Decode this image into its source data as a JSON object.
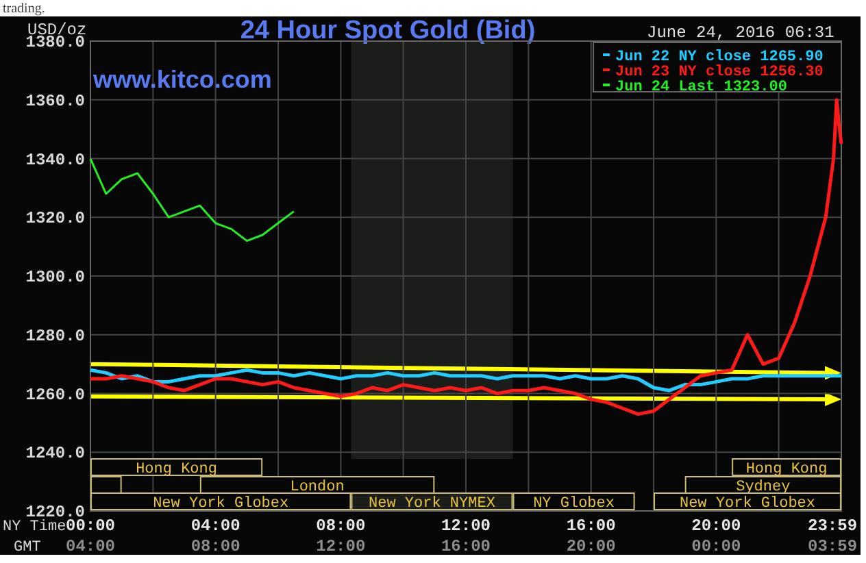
{
  "page_top_text": "trading.",
  "chart": {
    "unit_label": "USD/oz",
    "title": "24 Hour Spot Gold (Bid)",
    "timestamp": "June 24, 2016 06:31",
    "site_label": "www.kitco.com",
    "chart_data": {
      "type": "line",
      "x": [
        0,
        0.5,
        1,
        1.5,
        2,
        2.5,
        3,
        3.5,
        4,
        4.5,
        5,
        5.5,
        6,
        6.5,
        7,
        7.5,
        8,
        8.5,
        9,
        9.5,
        10,
        10.5,
        11,
        11.5,
        12,
        12.5,
        13,
        13.5,
        14,
        14.5,
        15,
        15.5,
        16,
        16.5,
        17,
        17.5,
        18,
        18.5,
        19,
        19.5,
        20,
        20.5,
        21,
        21.5,
        22,
        22.5,
        23,
        23.5,
        23.75,
        23.85,
        23.92,
        24
      ],
      "series": [
        {
          "name": "Jun 22 NY close 1265.90",
          "color": "#22ccff",
          "values": [
            1268,
            1267,
            1265,
            1266,
            1264,
            1264,
            1265,
            1266,
            1266,
            1267,
            1268,
            1267,
            1267,
            1266,
            1267,
            1266,
            1265,
            1266,
            1266,
            1267,
            1266,
            1266,
            1267,
            1266,
            1266,
            1266,
            1265,
            1266,
            1266,
            1266,
            1265,
            1266,
            1265,
            1265,
            1266,
            1265,
            1262,
            1261,
            1263,
            1263,
            1264,
            1265,
            1265,
            1266,
            1266,
            1266,
            1266,
            1266,
            1266,
            1266,
            1266,
            1266
          ]
        },
        {
          "name": "Jun 23 NY close 1256.30",
          "color": "#ff1a1a",
          "values": [
            1265,
            1265,
            1266,
            1265,
            1264,
            1262,
            1261,
            1263,
            1265,
            1265,
            1264,
            1263,
            1264,
            1262,
            1261,
            1260,
            1259,
            1260,
            1262,
            1261,
            1263,
            1262,
            1261,
            1262,
            1261,
            1262,
            1260,
            1261,
            1261,
            1262,
            1261,
            1260,
            1258,
            1257,
            1255,
            1253,
            1254,
            1258,
            1262,
            1266,
            1267,
            1268,
            1280,
            1270,
            1272,
            1284,
            1300,
            1320,
            1340,
            1360,
            1352,
            1345
          ]
        },
        {
          "name": "Jun 24 Last 1323.00",
          "color": "#22ee22",
          "values": [
            1340,
            1328,
            1333,
            1335,
            1328,
            1320,
            1322,
            1324,
            1318,
            1316,
            1312,
            1314,
            1318,
            1322,
            null,
            null,
            null,
            null,
            null,
            null,
            null,
            null,
            null,
            null,
            null,
            null,
            null,
            null,
            null,
            null,
            null,
            null,
            null,
            null,
            null,
            null,
            null,
            null,
            null,
            null,
            null,
            null,
            null,
            null,
            null,
            null,
            null,
            null,
            null,
            null,
            null,
            null
          ]
        }
      ],
      "xlim": [
        0,
        24
      ],
      "ylim": [
        1220,
        1380
      ],
      "xticks": [
        {
          "value": 0,
          "label": "00:00"
        },
        {
          "value": 4,
          "label": "04:00"
        },
        {
          "value": 8,
          "label": "08:00"
        },
        {
          "value": 12,
          "label": "12:00"
        },
        {
          "value": 16,
          "label": "16:00"
        },
        {
          "value": 20,
          "label": "20:00"
        },
        {
          "value": 23.98,
          "label": "23:59"
        }
      ],
      "yticks": [
        {
          "value": 1220,
          "label": "1220.0"
        },
        {
          "value": 1240,
          "label": "1240.0"
        },
        {
          "value": 1260,
          "label": "1260.0"
        },
        {
          "value": 1280,
          "label": "1280.0"
        },
        {
          "value": 1300,
          "label": "1300.0"
        },
        {
          "value": 1320,
          "label": "1320.0"
        },
        {
          "value": 1340,
          "label": "1340.0"
        },
        {
          "value": 1360,
          "label": "1360.0"
        },
        {
          "value": 1380,
          "label": "1380.0"
        }
      ],
      "grid": true,
      "legend": "upper right"
    },
    "primary_axis_label": "NY Time",
    "secondary_axis": {
      "label": "GMT",
      "tick_labels": [
        "04:00",
        "08:00",
        "12:00",
        "16:00",
        "20:00",
        "00:00",
        "03:59"
      ]
    },
    "sessions": [
      {
        "label": "Hong Kong",
        "kind": "top",
        "shaded": false
      },
      {
        "label": "Hong Kong",
        "kind": "top",
        "shaded": false
      },
      {
        "kind": "middle",
        "shaded": false
      },
      {
        "label": "London",
        "kind": "middle",
        "shaded": false
      },
      {
        "label": "Sydney",
        "kind": "middle",
        "shaded": false
      },
      {
        "label": "New York Globex",
        "kind": "bottom",
        "shaded": false
      },
      {
        "label": "New York NYMEX",
        "kind": "bottom",
        "shaded": true
      },
      {
        "label": "NY Globex",
        "kind": "bottom",
        "shaded": false
      },
      {
        "label": "New York Globex",
        "kind": "bottom",
        "shaded": false
      }
    ]
  }
}
